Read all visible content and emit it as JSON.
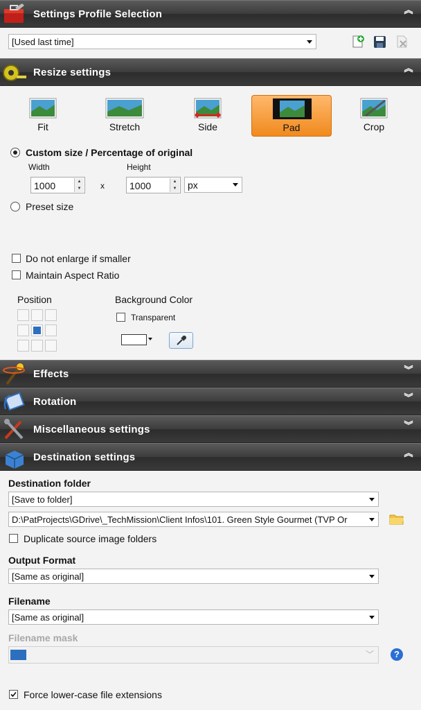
{
  "profile": {
    "title": "Settings Profile Selection",
    "selected": "[Used last time]"
  },
  "resize": {
    "title": "Resize settings",
    "modes": [
      "Fit",
      "Stretch",
      "Side",
      "Pad",
      "Crop"
    ],
    "custom_label": "Custom size / Percentage of original",
    "width_label": "Width",
    "height_label": "Height",
    "width_value": "1000",
    "height_value": "1000",
    "times": "x",
    "unit": "px",
    "preset_label": "Preset size",
    "no_enlarge_label": "Do not enlarge if smaller",
    "aspect_label": "Maintain Aspect Ratio",
    "position_label": "Position",
    "bg_color_label": "Background Color",
    "transparent_label": "Transparent"
  },
  "sections": {
    "effects": "Effects",
    "rotation": "Rotation",
    "misc": "Miscellaneous settings",
    "destination": "Destination settings"
  },
  "destination": {
    "folder_label": "Destination folder",
    "folder_mode": "[Save to folder]",
    "folder_path": "D:\\PatProjects\\GDrive\\_TechMission\\Client Infos\\101. Green Style Gourmet (TVP Or",
    "duplicate_label": "Duplicate source image folders",
    "output_label": "Output Format",
    "output_value": "[Same as original]",
    "filename_label": "Filename",
    "filename_value": "[Same as original]",
    "mask_label": "Filename mask",
    "lowercase_label": "Force lower-case file extensions"
  },
  "colors": {
    "active_mode": "#f08a1e",
    "header_bg": "#3c3c3c",
    "help_icon": "#2a6fd6"
  }
}
